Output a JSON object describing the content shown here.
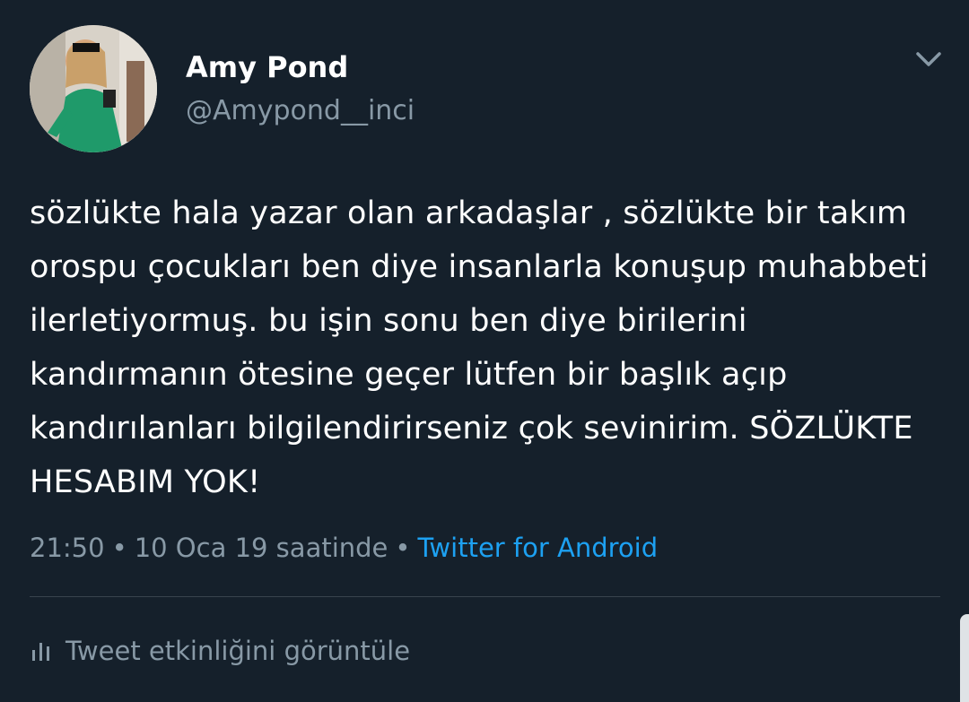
{
  "user": {
    "name": "Amy Pond",
    "handle": "@Amypond__inci",
    "avatar_icon": "profile-photo"
  },
  "tweet": {
    "text": "sözlükte hala yazar olan arkadaşlar , sözlükte bir takım orospu çocukları ben diye insanlarla konuşup muhabbeti ilerletiyormuş. bu işin sonu ben diye birilerini kandırmanın ötesine geçer lütfen bir başlık açıp kandırılanları bilgilendirirseniz çok sevinirim. SÖZLÜKTE HESABIM YOK!",
    "time": "21:50",
    "date": "10 Oca 19 saatinde",
    "separator": "•",
    "source": "Twitter for Android"
  },
  "actions": {
    "activity_label": "Tweet etkinliğini görüntüle",
    "activity_icon": "bar-chart-icon",
    "menu_icon": "chevron-down-icon"
  },
  "colors": {
    "background": "#15202b",
    "text": "#ffffff",
    "secondary": "#8899a6",
    "accent": "#1da1f2",
    "divider": "#38444d"
  }
}
